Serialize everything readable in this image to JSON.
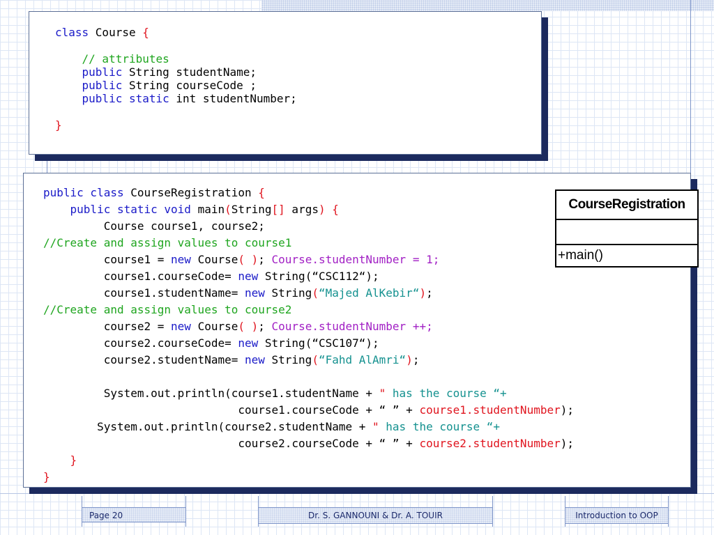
{
  "course_class": {
    "lines": [
      [
        {
          "t": "class ",
          "c": "kw"
        },
        {
          "t": "Course ",
          "c": ""
        },
        {
          "t": "{",
          "c": "rd"
        }
      ],
      [
        {
          "t": " ",
          "c": ""
        }
      ],
      [
        {
          "t": "    // attributes",
          "c": "cm"
        }
      ],
      [
        {
          "t": "    public ",
          "c": "kw"
        },
        {
          "t": "String studentName;",
          "c": ""
        }
      ],
      [
        {
          "t": "    public ",
          "c": "kw"
        },
        {
          "t": "String courseCode ;",
          "c": ""
        }
      ],
      [
        {
          "t": "    public static ",
          "c": "kw"
        },
        {
          "t": "int studentNumber;",
          "c": ""
        }
      ],
      [
        {
          "t": " ",
          "c": ""
        }
      ],
      [
        {
          "t": "}",
          "c": "rd"
        }
      ]
    ]
  },
  "registration_class": {
    "lines": [
      [
        {
          "t": "public class ",
          "c": "kw"
        },
        {
          "t": "CourseRegistration ",
          "c": ""
        },
        {
          "t": "{",
          "c": "rd"
        }
      ],
      [
        {
          "t": "    public static void ",
          "c": "kw"
        },
        {
          "t": "main",
          "c": ""
        },
        {
          "t": "(",
          "c": "rd"
        },
        {
          "t": "String",
          "c": ""
        },
        {
          "t": "[]",
          "c": "rd"
        },
        {
          "t": " args",
          "c": ""
        },
        {
          "t": ")",
          "c": "rd"
        },
        {
          "t": " {",
          "c": "rd"
        }
      ],
      [
        {
          "t": "         Course course1, course2;",
          "c": ""
        }
      ],
      [
        {
          "t": "//Create and assign values to course1",
          "c": "cm"
        }
      ],
      [
        {
          "t": "         course1 = ",
          "c": ""
        },
        {
          "t": "new ",
          "c": "kw"
        },
        {
          "t": "Course",
          "c": ""
        },
        {
          "t": "( )",
          "c": "rd"
        },
        {
          "t": "; ",
          "c": ""
        },
        {
          "t": "Course.studentNumber = 1;",
          "c": "pu"
        }
      ],
      [
        {
          "t": "         course1.courseCode= ",
          "c": ""
        },
        {
          "t": "new ",
          "c": "kw"
        },
        {
          "t": "String(“CSC112“);",
          "c": ""
        }
      ],
      [
        {
          "t": "         course1.studentName= ",
          "c": ""
        },
        {
          "t": "new ",
          "c": "kw"
        },
        {
          "t": "String",
          "c": ""
        },
        {
          "t": "(",
          "c": "rd"
        },
        {
          "t": "“Majed AlKebir“",
          "c": "tl"
        },
        {
          "t": ")",
          "c": "rd"
        },
        {
          "t": ";",
          "c": ""
        }
      ],
      [
        {
          "t": "//Create and assign values to course2",
          "c": "cm"
        }
      ],
      [
        {
          "t": "         course2 = ",
          "c": ""
        },
        {
          "t": "new ",
          "c": "kw"
        },
        {
          "t": "Course",
          "c": ""
        },
        {
          "t": "( )",
          "c": "rd"
        },
        {
          "t": "; ",
          "c": ""
        },
        {
          "t": "Course.studentNumber ++;",
          "c": "pu"
        }
      ],
      [
        {
          "t": "         course2.courseCode= ",
          "c": ""
        },
        {
          "t": "new ",
          "c": "kw"
        },
        {
          "t": "String(“CSC107“);",
          "c": ""
        }
      ],
      [
        {
          "t": "         course2.studentName= ",
          "c": ""
        },
        {
          "t": "new ",
          "c": "kw"
        },
        {
          "t": "String",
          "c": ""
        },
        {
          "t": "(",
          "c": "rd"
        },
        {
          "t": "“Fahd AlAmri“",
          "c": "tl"
        },
        {
          "t": ")",
          "c": "rd"
        },
        {
          "t": ";",
          "c": ""
        }
      ],
      [
        {
          "t": " ",
          "c": ""
        }
      ],
      [
        {
          "t": "         System.out.println(course1.studentName + ",
          "c": ""
        },
        {
          "t": "\"",
          "c": "rd"
        },
        {
          "t": " has the course “+",
          "c": "tl"
        }
      ],
      [
        {
          "t": "                             course1.courseCode + “ ” + ",
          "c": ""
        },
        {
          "t": "course1.studentNumber",
          "c": "rd"
        },
        {
          "t": ");",
          "c": ""
        }
      ],
      [
        {
          "t": "        System.out.println(course2.studentName + ",
          "c": ""
        },
        {
          "t": "\"",
          "c": "rd"
        },
        {
          "t": " has the course “+",
          "c": "tl"
        }
      ],
      [
        {
          "t": "                             course2.courseCode + “ ” + ",
          "c": ""
        },
        {
          "t": "course2.studentNumber",
          "c": "rd"
        },
        {
          "t": ");",
          "c": ""
        }
      ],
      [
        {
          "t": "    }",
          "c": "rd"
        }
      ],
      [
        {
          "t": "}",
          "c": "rd"
        }
      ]
    ]
  },
  "uml": {
    "class_name": "CourseRegistration",
    "operation": "+main()"
  },
  "footer": {
    "page": "Page 20",
    "authors": "Dr. S. GANNOUNI & Dr.  A. TOUIR",
    "title": "Introduction to OOP"
  },
  "colors": {
    "keyword": "#1a1ac8",
    "comment": "#1fa51f",
    "red": "#e0141e",
    "purple": "#a11fc4",
    "teal": "#14918f",
    "shadow": "#1c2a5e"
  }
}
